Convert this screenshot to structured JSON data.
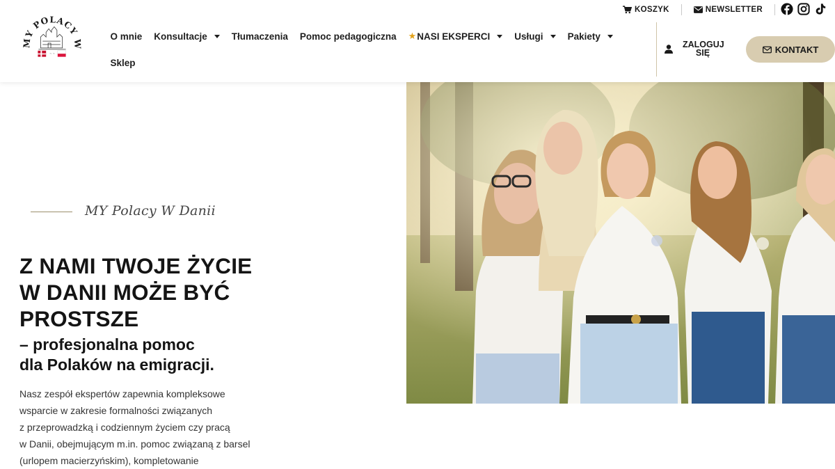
{
  "logo": {
    "arc_text": "MY POLACY W DANII"
  },
  "topbar": {
    "cart_label": "KOSZYK",
    "newsletter_label": "NEWSLETTER"
  },
  "nav": {
    "items": [
      {
        "label": "O mnie"
      },
      {
        "label": "Konsultacje"
      },
      {
        "label": "Tłumaczenia"
      },
      {
        "label": "Pomoc pedagogiczna"
      },
      {
        "label": "NASI EKSPERCI"
      },
      {
        "label": "Usługi"
      },
      {
        "label": "Pakiety"
      },
      {
        "label": "Sklep"
      }
    ]
  },
  "header": {
    "login_line1": "ZALOGUJ",
    "login_line2": "SIĘ",
    "contact_label": "KONTAKT"
  },
  "hero": {
    "tagline": "MY Polacy W Danii",
    "headline": [
      "Z NAMI TWOJE ŻYCIE",
      "W DANII MOŻE BYĆ",
      "PROSTSZE"
    ],
    "subheadline": [
      "– profesjonalna pomoc",
      "dla Polaków na emigracji."
    ],
    "body": [
      "Nasz zespół ekspertów zapewnia kompleksowe",
      "wsparcie w zakresie formalności związanych",
      "z przeprowadzką i codziennym życiem czy pracą",
      "w Danii, obejmującym m.in. pomoc związaną z barsel",
      "(urlopem macierzyńskim), kompletowanie"
    ]
  },
  "colors": {
    "accent": "#d8ccb0",
    "star": "#e3a21a",
    "divider": "#cfc4a8"
  }
}
